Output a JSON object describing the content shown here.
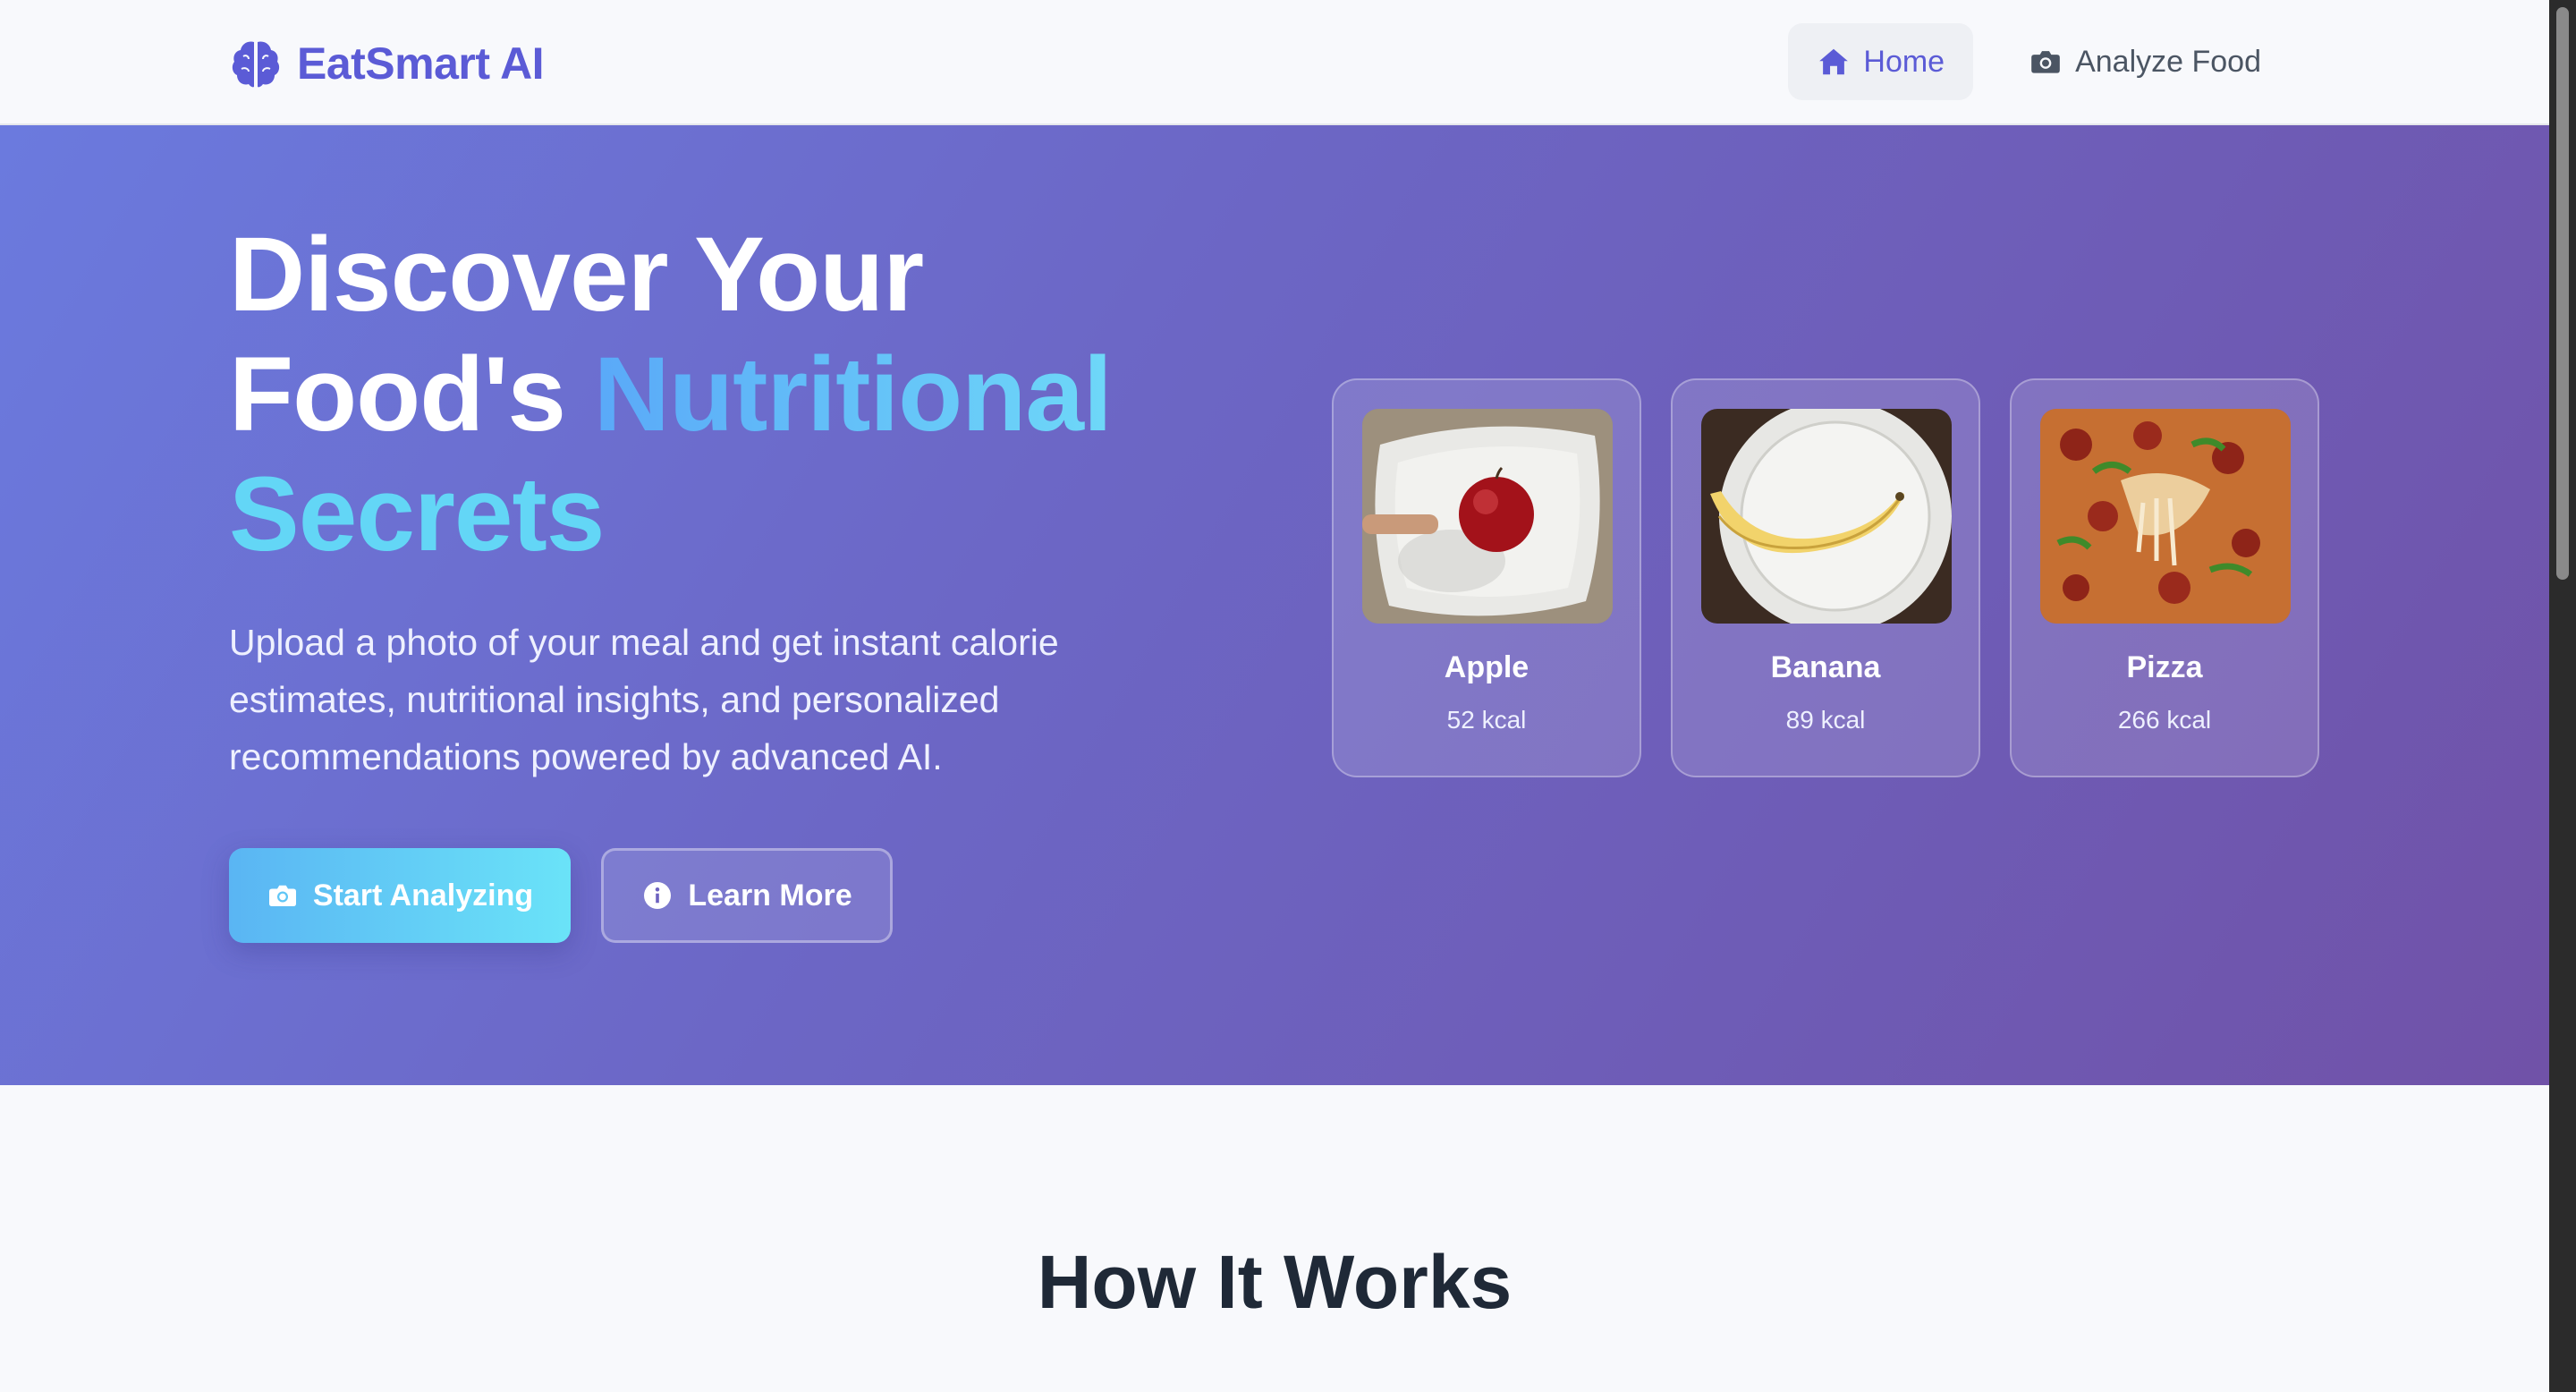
{
  "brand": {
    "name": "EatSmart AI",
    "icon": "brain-icon",
    "color": "#5b5bd6"
  },
  "nav": {
    "items": [
      {
        "label": "Home",
        "icon": "home-icon",
        "active": true
      },
      {
        "label": "Analyze Food",
        "icon": "camera-icon",
        "active": false
      }
    ]
  },
  "hero": {
    "title_line1": "Discover Your",
    "title_line2_plain": "Food's ",
    "title_line2_accent": "Nutritional",
    "title_line3_accent": "Secrets",
    "description": "Upload a photo of your meal and get instant calorie estimates, nutritional insights, and personalized recommendations powered by advanced AI.",
    "primary_button": {
      "label": "Start Analyzing",
      "icon": "camera-icon"
    },
    "secondary_button": {
      "label": "Learn More",
      "icon": "info-icon"
    },
    "gradient": [
      "#6b7ade",
      "#7052a8"
    ],
    "accent_colors": [
      "#5aa9f8",
      "#6ed8f8"
    ]
  },
  "food_cards": [
    {
      "name": "Apple",
      "kcal": "52 kcal"
    },
    {
      "name": "Banana",
      "kcal": "89 kcal"
    },
    {
      "name": "Pizza",
      "kcal": "266 kcal"
    }
  ],
  "section": {
    "title": "How It Works"
  }
}
